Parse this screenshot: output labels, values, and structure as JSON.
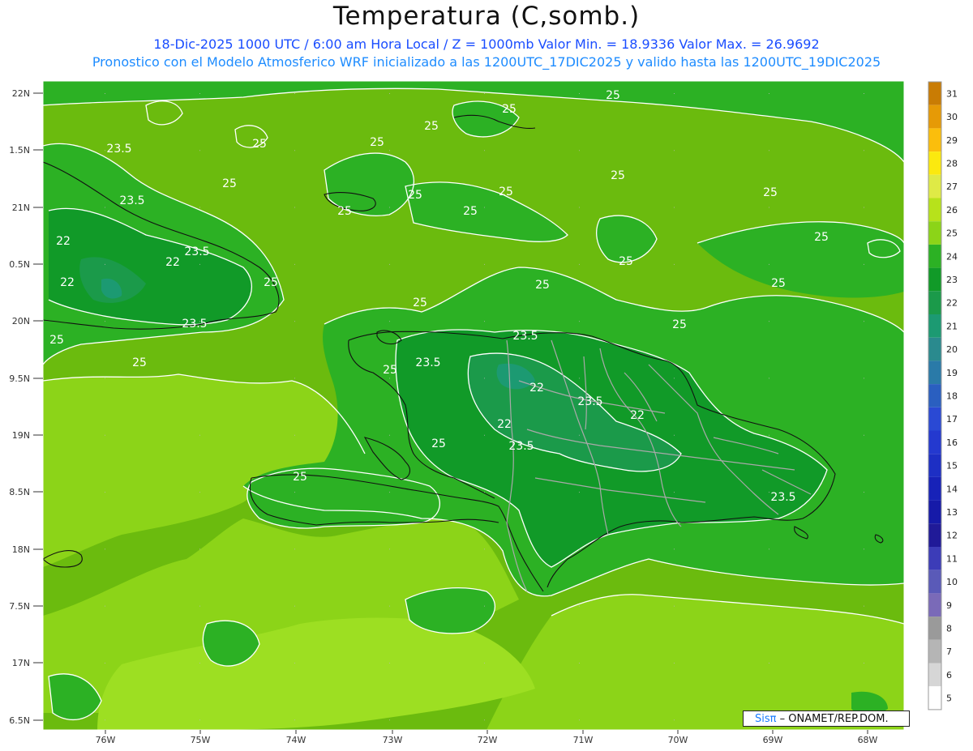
{
  "header": {
    "title": "Temperatura (C,somb.)",
    "subtitle_line1": "18-Dic-2025  1000 UTC / 6:00 am Hora Local / Z = 1000mb    Valor Min. = 18.9336  Valor Max. = 26.9692",
    "subtitle_line2": "Pronostico con el Modelo Atmosferico WRF inicializado a las 1200UTC_17DIC2025 y valido hasta las  1200UTC_19DIC2025"
  },
  "map": {
    "lat_labels": [
      "22N",
      "1.5N",
      "21N",
      "0.5N",
      "20N",
      "9.5N",
      "19N",
      "8.5N",
      "18N",
      "7.5N",
      "17N",
      "6.5N"
    ],
    "lon_labels": [
      "76W",
      "75W",
      "74W",
      "73W",
      "72W",
      "71W",
      "70W",
      "69W",
      "68W"
    ],
    "contour_labels": [
      "25",
      "25",
      "25",
      "25",
      "25",
      "25",
      "25",
      "25",
      "25",
      "25",
      "25",
      "25",
      "25",
      "25",
      "25",
      "25",
      "25",
      "25",
      "25",
      "25",
      "25",
      "25",
      "25",
      "25",
      "23.5",
      "23.5",
      "23.5",
      "23.5",
      "23.5",
      "23.5",
      "23.5",
      "23.5",
      "23.5",
      "22",
      "22",
      "22",
      "22",
      "22",
      "22"
    ]
  },
  "colorbar": {
    "levels": [
      "31",
      "30",
      "29",
      "28",
      "27",
      "26",
      "25",
      "24",
      "23",
      "22",
      "21",
      "20",
      "19",
      "18",
      "17",
      "16",
      "15",
      "14",
      "13",
      "12",
      "11",
      "10",
      "9",
      "8",
      "7",
      "6",
      "5"
    ],
    "colors": [
      "#c97c04",
      "#e69a06",
      "#fbbe0c",
      "#fbe90f",
      "#dfea46",
      "#b7e21b",
      "#8cd418",
      "#2cb124",
      "#119a28",
      "#1b9a4a",
      "#1c9a72",
      "#2a8a8e",
      "#2a7aa8",
      "#2a5fc0",
      "#2a49d4",
      "#2439cf",
      "#1d2fc4",
      "#1722b8",
      "#161aa8",
      "#201a98",
      "#3c3cb8",
      "#5a5ab8",
      "#7a6ab8",
      "#9a9a9a",
      "#b5b5b5",
      "#d6d6d6",
      "#ffffff"
    ]
  },
  "credit": {
    "logo": "Sisπ",
    "text": "– ONAMET/REP.DOM."
  }
}
